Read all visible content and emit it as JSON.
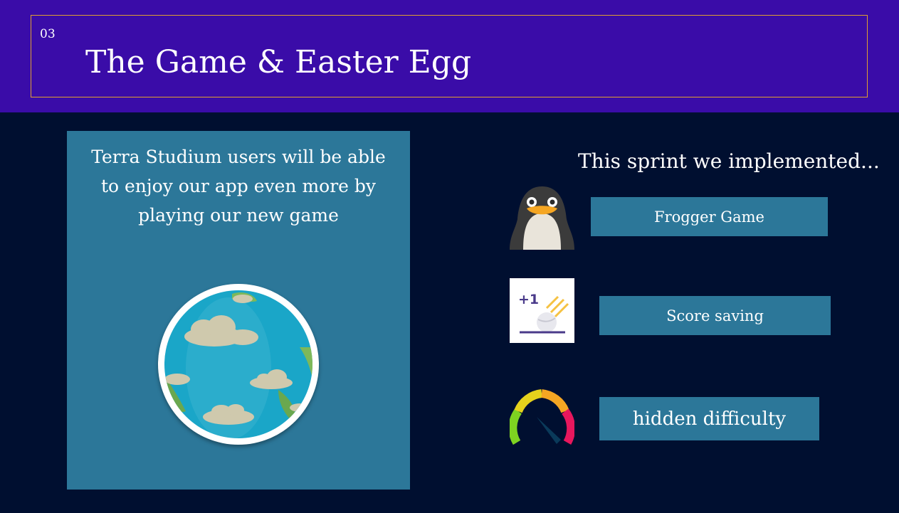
{
  "slide": {
    "number": "03",
    "title": "The Game & Easter Egg"
  },
  "left_panel": {
    "text": "Terra Studium users will be able to enjoy our app even more by playing our new game",
    "image_icon": "earth-globe-icon"
  },
  "right_panel": {
    "heading": "This sprint we implemented...",
    "features": [
      {
        "label": "Frogger Game",
        "icon": "penguin-icon"
      },
      {
        "label": "Score saving",
        "icon": "plus-one-score-icon",
        "icon_text": "+1"
      },
      {
        "label": "hidden difficulty",
        "icon": "speedometer-icon"
      }
    ]
  },
  "colors": {
    "header_bg": "#3a0ca8",
    "header_border": "#e0a030",
    "page_bg": "#000f30",
    "panel_bg": "#2c7799",
    "text": "#ffffff"
  }
}
